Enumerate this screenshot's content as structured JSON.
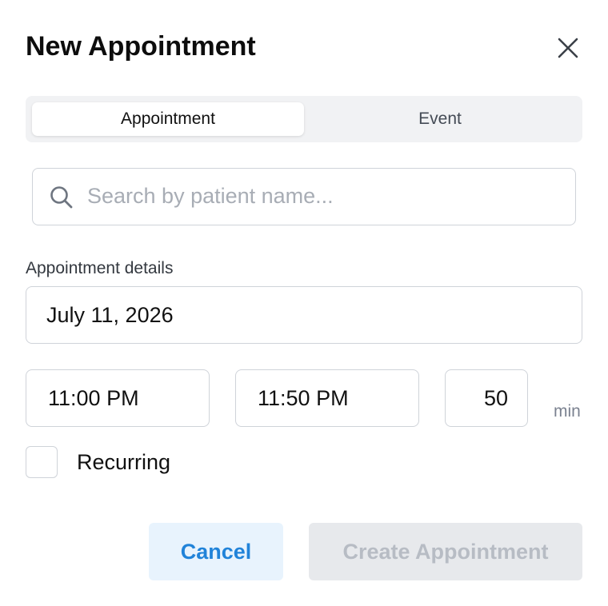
{
  "dialog": {
    "title": "New Appointment"
  },
  "tabs": [
    {
      "label": "Appointment",
      "active": true
    },
    {
      "label": "Event",
      "active": false
    }
  ],
  "search": {
    "placeholder": "Search by patient name...",
    "value": ""
  },
  "details": {
    "section_label": "Appointment details",
    "date": "July 11, 2026",
    "start_time": "11:00 PM",
    "end_time": "11:50 PM",
    "duration": "50",
    "duration_unit": "min",
    "recurring_label": "Recurring",
    "recurring_checked": false
  },
  "actions": {
    "cancel_label": "Cancel",
    "create_label": "Create Appointment",
    "create_disabled": true
  },
  "icons": {
    "close": "close-icon",
    "search": "search-icon"
  },
  "colors": {
    "accent": "#2183d9",
    "cancel_bg": "#e8f3fd",
    "disabled_bg": "#e7e9ec",
    "disabled_text": "#b7bcc4",
    "border": "#cfd3d9",
    "segmented_bg": "#f1f2f4"
  }
}
